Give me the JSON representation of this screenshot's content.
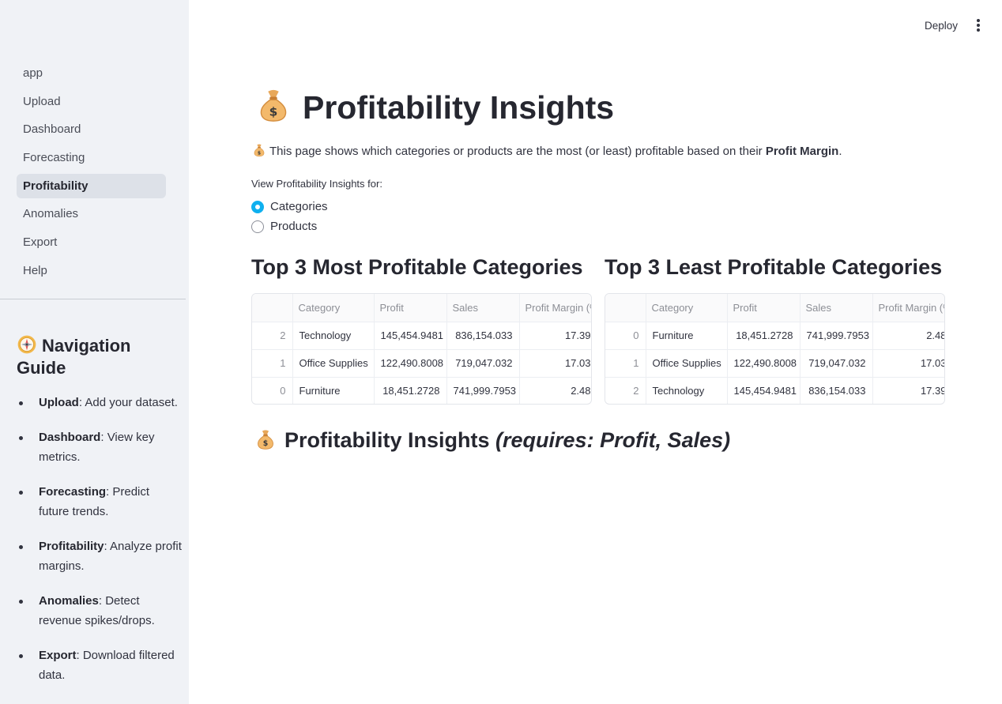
{
  "sidebar": {
    "nav": [
      {
        "label": "app",
        "active": false
      },
      {
        "label": "Upload",
        "active": false
      },
      {
        "label": "Dashboard",
        "active": false
      },
      {
        "label": "Forecasting",
        "active": false
      },
      {
        "label": "Profitability",
        "active": true
      },
      {
        "label": "Anomalies",
        "active": false
      },
      {
        "label": "Export",
        "active": false
      },
      {
        "label": "Help",
        "active": false
      }
    ],
    "guide_title": "Navigation Guide",
    "guide_items": [
      {
        "term": "Upload",
        "desc": ": Add your dataset."
      },
      {
        "term": "Dashboard",
        "desc": ": View key metrics."
      },
      {
        "term": "Forecasting",
        "desc": ": Predict future trends."
      },
      {
        "term": "Profitability",
        "desc": ": Analyze profit margins."
      },
      {
        "term": "Anomalies",
        "desc": ": Detect revenue spikes/drops."
      },
      {
        "term": "Export",
        "desc": ": Download filtered data."
      }
    ]
  },
  "header": {
    "deploy_label": "Deploy",
    "menu_icon": "kebab-menu-icon"
  },
  "page": {
    "title": "Profitability Insights",
    "title_icon": "money-bag-icon",
    "intro_prefix": "This page shows which categories or products are the most (or least) profitable based on their ",
    "intro_bold": "Profit Margin",
    "intro_suffix": ".",
    "radio_label": "View Profitability Insights for:",
    "radio_options": [
      {
        "label": "Categories",
        "selected": true
      },
      {
        "label": "Products",
        "selected": false
      }
    ]
  },
  "tables": {
    "columns": [
      "",
      "Category",
      "Profit",
      "Sales",
      "Profit Margin (%)"
    ],
    "most": {
      "heading": "Top 3 Most Profitable Categories",
      "rows": [
        [
          "2",
          "Technology",
          "145,454.9481",
          "836,154.033",
          "17.39"
        ],
        [
          "1",
          "Office Supplies",
          "122,490.8008",
          "719,047.032",
          "17.03"
        ],
        [
          "0",
          "Furniture",
          "18,451.2728",
          "741,999.7953",
          "2.48"
        ]
      ]
    },
    "least": {
      "heading": "Top 3 Least Profitable Categories",
      "rows": [
        [
          "0",
          "Furniture",
          "18,451.2728",
          "741,999.7953",
          "2.48"
        ],
        [
          "1",
          "Office Supplies",
          "122,490.8008",
          "719,047.032",
          "17.03"
        ],
        [
          "2",
          "Technology",
          "145,454.9481",
          "836,154.033",
          "17.39"
        ]
      ]
    }
  },
  "subheading": {
    "main": "Profitability Insights ",
    "italic": "(requires: Profit, Sales)"
  }
}
